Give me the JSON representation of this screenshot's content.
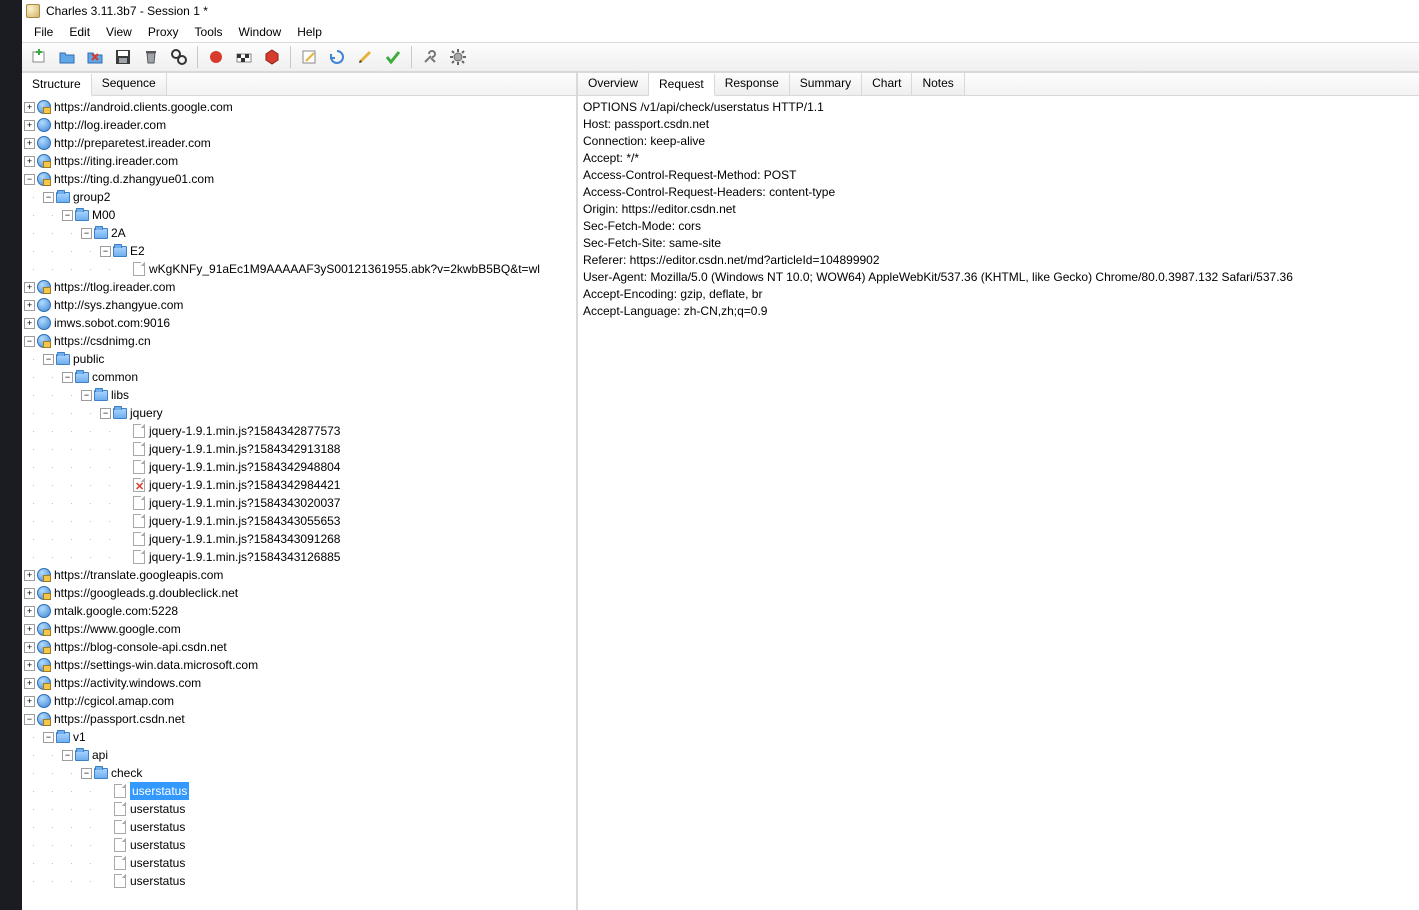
{
  "title": "Charles 3.11.3b7 - Session 1 *",
  "menu": [
    "File",
    "Edit",
    "View",
    "Proxy",
    "Tools",
    "Window",
    "Help"
  ],
  "left_tabs": [
    "Structure",
    "Sequence"
  ],
  "left_active_tab": 0,
  "right_tabs": [
    "Overview",
    "Request",
    "Response",
    "Summary",
    "Chart",
    "Notes"
  ],
  "right_active_tab": 1,
  "tree": [
    {
      "t": "host",
      "exp": "c",
      "lock": true,
      "ind": 0,
      "label": "https://android.clients.google.com"
    },
    {
      "t": "host",
      "exp": "c",
      "lock": false,
      "ind": 0,
      "label": "http://log.ireader.com"
    },
    {
      "t": "host",
      "exp": "c",
      "lock": false,
      "ind": 0,
      "label": "http://preparetest.ireader.com"
    },
    {
      "t": "host",
      "exp": "c",
      "lock": true,
      "ind": 0,
      "label": "https://iting.ireader.com"
    },
    {
      "t": "host",
      "exp": "e",
      "lock": true,
      "ind": 0,
      "label": "https://ting.d.zhangyue01.com"
    },
    {
      "t": "folder",
      "exp": "e",
      "ind": 1,
      "label": "group2"
    },
    {
      "t": "folder",
      "exp": "e",
      "ind": 2,
      "label": "M00"
    },
    {
      "t": "folder",
      "exp": "e",
      "ind": 3,
      "label": "2A"
    },
    {
      "t": "folder",
      "exp": "e",
      "ind": 4,
      "label": "E2"
    },
    {
      "t": "file",
      "exp": "n",
      "ind": 5,
      "last": true,
      "label": "wKgKNFy_91aEc1M9AAAAAF3yS00121361955.abk?v=2kwbB5BQ&t=wl"
    },
    {
      "t": "host",
      "exp": "c",
      "lock": true,
      "ind": 0,
      "label": "https://tlog.ireader.com"
    },
    {
      "t": "host",
      "exp": "c",
      "lock": false,
      "ind": 0,
      "label": "http://sys.zhangyue.com"
    },
    {
      "t": "host",
      "exp": "c",
      "lock": false,
      "ind": 0,
      "label": "imws.sobot.com:9016"
    },
    {
      "t": "host",
      "exp": "e",
      "lock": true,
      "ind": 0,
      "label": "https://csdnimg.cn"
    },
    {
      "t": "folder",
      "exp": "e",
      "ind": 1,
      "label": "public"
    },
    {
      "t": "folder",
      "exp": "e",
      "ind": 2,
      "label": "common"
    },
    {
      "t": "folder",
      "exp": "e",
      "ind": 3,
      "label": "libs"
    },
    {
      "t": "folder",
      "exp": "e",
      "ind": 4,
      "label": "jquery"
    },
    {
      "t": "file",
      "exp": "n",
      "ind": 5,
      "label": "jquery-1.9.1.min.js?1584342877573"
    },
    {
      "t": "file",
      "exp": "n",
      "ind": 5,
      "label": "jquery-1.9.1.min.js?1584342913188"
    },
    {
      "t": "file",
      "exp": "n",
      "ind": 5,
      "label": "jquery-1.9.1.min.js?1584342948804"
    },
    {
      "t": "file",
      "exp": "n",
      "ind": 5,
      "err": true,
      "label": "jquery-1.9.1.min.js?1584342984421"
    },
    {
      "t": "file",
      "exp": "n",
      "ind": 5,
      "label": "jquery-1.9.1.min.js?1584343020037"
    },
    {
      "t": "file",
      "exp": "n",
      "ind": 5,
      "label": "jquery-1.9.1.min.js?1584343055653"
    },
    {
      "t": "file",
      "exp": "n",
      "ind": 5,
      "label": "jquery-1.9.1.min.js?1584343091268"
    },
    {
      "t": "file",
      "exp": "n",
      "ind": 5,
      "last": true,
      "label": "jquery-1.9.1.min.js?1584343126885"
    },
    {
      "t": "host",
      "exp": "c",
      "lock": true,
      "ind": 0,
      "label": "https://translate.googleapis.com"
    },
    {
      "t": "host",
      "exp": "c",
      "lock": true,
      "ind": 0,
      "label": "https://googleads.g.doubleclick.net"
    },
    {
      "t": "host",
      "exp": "c",
      "lock": false,
      "ind": 0,
      "label": "mtalk.google.com:5228"
    },
    {
      "t": "host",
      "exp": "c",
      "lock": true,
      "ind": 0,
      "label": "https://www.google.com"
    },
    {
      "t": "host",
      "exp": "c",
      "lock": true,
      "ind": 0,
      "label": "https://blog-console-api.csdn.net"
    },
    {
      "t": "host",
      "exp": "c",
      "lock": true,
      "ind": 0,
      "label": "https://settings-win.data.microsoft.com"
    },
    {
      "t": "host",
      "exp": "c",
      "lock": true,
      "ind": 0,
      "label": "https://activity.windows.com"
    },
    {
      "t": "host",
      "exp": "c",
      "lock": false,
      "ind": 0,
      "label": "http://cgicol.amap.com"
    },
    {
      "t": "host",
      "exp": "e",
      "lock": true,
      "ind": 0,
      "label": "https://passport.csdn.net"
    },
    {
      "t": "folder",
      "exp": "e",
      "ind": 1,
      "label": "v1"
    },
    {
      "t": "folder",
      "exp": "e",
      "ind": 2,
      "label": "api"
    },
    {
      "t": "folder",
      "exp": "e",
      "ind": 3,
      "label": "check"
    },
    {
      "t": "file",
      "exp": "n",
      "ind": 4,
      "sel": true,
      "label": "userstatus"
    },
    {
      "t": "file",
      "exp": "n",
      "ind": 4,
      "label": "userstatus"
    },
    {
      "t": "file",
      "exp": "n",
      "ind": 4,
      "label": "userstatus"
    },
    {
      "t": "file",
      "exp": "n",
      "ind": 4,
      "label": "userstatus"
    },
    {
      "t": "file",
      "exp": "n",
      "ind": 4,
      "label": "userstatus"
    },
    {
      "t": "file",
      "exp": "n",
      "ind": 4,
      "label": "userstatus"
    }
  ],
  "request_lines": [
    "OPTIONS /v1/api/check/userstatus HTTP/1.1",
    "Host: passport.csdn.net",
    "Connection: keep-alive",
    "Accept: */*",
    "Access-Control-Request-Method: POST",
    "Access-Control-Request-Headers: content-type",
    "Origin: https://editor.csdn.net",
    "Sec-Fetch-Mode: cors",
    "Sec-Fetch-Site: same-site",
    "Referer: https://editor.csdn.net/md?articleId=104899902",
    "User-Agent: Mozilla/5.0 (Windows NT 10.0; WOW64) AppleWebKit/537.36 (KHTML, like Gecko) Chrome/80.0.3987.132 Safari/537.36",
    "Accept-Encoding: gzip, deflate, br",
    "Accept-Language: zh-CN,zh;q=0.9"
  ]
}
